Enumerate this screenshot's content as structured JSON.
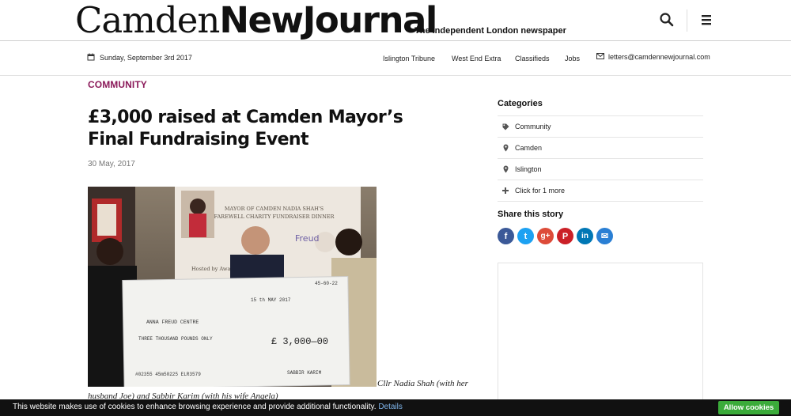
{
  "header": {
    "logo_light": "Camden",
    "logo_bold": "NewJournal",
    "tagline": "The independent London newspaper",
    "search_icon": "search-icon",
    "menu_icon": "menu-icon"
  },
  "subbar": {
    "date": "Sunday, September 3rd 2017",
    "nav": [
      "Islington Tribune",
      "West End Extra",
      "Classifieds",
      "Jobs"
    ],
    "email": "letters@camdennewjournal.com"
  },
  "article": {
    "section": "COMMUNITY",
    "title": "£3,000 raised at Camden Mayor’s Final Fundraising Event",
    "date": "30 May, 2017",
    "caption": "Cllr Nadia Shah (with her husband Joe) and Sabbir Karim (with his wife Angela)"
  },
  "photo": {
    "banner_line1": "MAYOR OF CAMDEN NADIA SHAH'S",
    "banner_line2": "FAREWELL CHARITY FUNDRAISER DINNER",
    "hosted": "Hosted by Awa",
    "freud": "Freud",
    "cheque_payee": "ANNA FREUD CENTRE",
    "cheque_words": "THREE THOUSAND POUNDS ONLY",
    "cheque_amount": "£ 3,000—00",
    "cheque_date": "15 th MAY 2017",
    "cheque_sort": "45-60-22",
    "cheque_sign": "SABBIR KARIM",
    "cheque_code": "#02355 45m50225 ELR3579"
  },
  "sidebar": {
    "categories_title": "Categories",
    "categories": [
      {
        "label": "Community",
        "icon": "tag-icon"
      },
      {
        "label": "Camden",
        "icon": "map-pin-icon"
      },
      {
        "label": "Islington",
        "icon": "map-pin-icon"
      },
      {
        "label": "Click for 1 more",
        "icon": "plus-icon"
      }
    ],
    "share_title": "Share this story",
    "share": [
      {
        "name": "facebook",
        "glyph": "f",
        "color": "#3b5998"
      },
      {
        "name": "twitter",
        "glyph": "t",
        "color": "#1da1f2"
      },
      {
        "name": "google-plus",
        "glyph": "g+",
        "color": "#dd4b39"
      },
      {
        "name": "pinterest",
        "glyph": "P",
        "color": "#cb2027"
      },
      {
        "name": "linkedin",
        "glyph": "in",
        "color": "#0077b5"
      },
      {
        "name": "email",
        "glyph": "✉",
        "color": "#2a7fd4"
      }
    ]
  },
  "cookie": {
    "text": "This website makes use of cookies to enhance browsing experience and provide additional functionality.",
    "details": "Details",
    "button": "Allow cookies"
  }
}
